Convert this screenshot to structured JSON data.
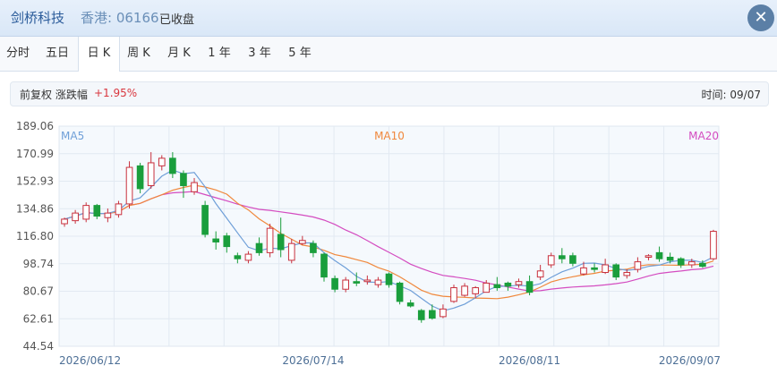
{
  "header": {
    "stock_name": "剑桥科技",
    "market": "香港: 06166",
    "status": "已收盘",
    "close_icon": "close-icon"
  },
  "tabs": [
    {
      "label": "分时"
    },
    {
      "label": "五日"
    },
    {
      "label": "日 K",
      "active": true
    },
    {
      "label": "周 K"
    },
    {
      "label": "月 K"
    },
    {
      "label": "1 年"
    },
    {
      "label": "3 年"
    },
    {
      "label": "5 年"
    }
  ],
  "info": {
    "adjust": "前复权 涨跌幅",
    "change": "+1.95%",
    "time": "时间: 09/07"
  },
  "colors": {
    "up": "#c8303d",
    "down": "#1a9e3c",
    "ma5": "#6f9fd8",
    "ma10": "#f0883c",
    "ma20": "#d44cc0"
  },
  "chart_data": {
    "type": "candlestick",
    "y_ticks": [
      "189.06",
      "170.99",
      "152.93",
      "134.86",
      "116.80",
      "98.74",
      "80.67",
      "62.61",
      "44.54"
    ],
    "ylim": [
      44.54,
      189.06
    ],
    "x_labels": [
      {
        "label": "2026/06/12",
        "index": 5
      },
      {
        "label": "2026/07/14",
        "index": 23
      },
      {
        "label": "2026/08/11",
        "index": 43
      },
      {
        "label": "2026/09/07",
        "index": 60
      }
    ],
    "legend": [
      "MA5",
      "MA10",
      "MA20"
    ],
    "grid": true,
    "candles": [
      [
        125,
        128,
        123,
        129
      ],
      [
        127,
        132,
        125,
        134
      ],
      [
        128,
        137,
        126,
        139
      ],
      [
        137,
        130,
        128,
        138
      ],
      [
        129,
        132,
        126,
        135
      ],
      [
        131,
        138,
        129,
        140
      ],
      [
        138,
        162,
        135,
        166
      ],
      [
        163,
        148,
        145,
        165
      ],
      [
        150,
        165,
        148,
        172
      ],
      [
        163,
        168,
        160,
        170
      ],
      [
        168,
        158,
        155,
        172
      ],
      [
        158,
        150,
        142,
        160
      ],
      [
        146,
        152,
        144,
        155
      ],
      [
        137,
        118,
        116,
        140
      ],
      [
        115,
        113,
        108,
        120
      ],
      [
        117,
        110,
        106,
        119
      ],
      [
        104,
        102,
        99,
        106
      ],
      [
        101,
        105,
        99,
        107
      ],
      [
        112,
        106,
        104,
        116
      ],
      [
        106,
        122,
        103,
        125
      ],
      [
        118,
        108,
        103,
        129
      ],
      [
        101,
        112,
        99,
        115
      ],
      [
        112,
        114,
        111,
        117
      ],
      [
        112,
        106,
        103,
        114
      ],
      [
        105,
        90,
        87,
        106
      ],
      [
        89,
        82,
        80,
        91
      ],
      [
        82,
        88,
        80,
        90
      ],
      [
        87,
        86,
        84,
        93
      ],
      [
        87,
        88,
        85,
        91
      ],
      [
        85,
        88,
        83,
        90
      ],
      [
        92,
        85,
        83,
        93
      ],
      [
        86,
        74,
        72,
        87
      ],
      [
        73,
        71,
        70,
        75
      ],
      [
        68,
        62,
        60,
        69
      ],
      [
        68,
        63,
        62,
        72
      ],
      [
        64,
        69,
        63,
        72
      ],
      [
        74,
        83,
        73,
        85
      ],
      [
        78,
        84,
        77,
        86
      ],
      [
        79,
        83,
        76,
        84
      ],
      [
        80,
        86,
        80,
        88
      ],
      [
        85,
        83,
        81,
        90
      ],
      [
        86,
        84,
        81,
        87
      ],
      [
        85,
        87,
        83,
        89
      ],
      [
        87,
        80,
        78,
        91
      ],
      [
        90,
        94,
        88,
        98
      ],
      [
        98,
        104,
        96,
        106
      ],
      [
        104,
        102,
        99,
        109
      ],
      [
        104,
        99,
        97,
        106
      ],
      [
        92,
        96,
        91,
        100
      ],
      [
        96,
        95,
        93,
        99
      ],
      [
        93,
        98,
        92,
        102
      ],
      [
        98,
        90,
        88,
        99
      ],
      [
        91,
        93,
        89,
        95
      ],
      [
        95,
        100,
        93,
        103
      ],
      [
        103,
        104,
        101,
        105
      ],
      [
        106,
        102,
        100,
        110
      ],
      [
        103,
        101,
        99,
        106
      ],
      [
        102,
        98,
        96,
        103
      ],
      [
        98,
        100,
        96,
        102
      ],
      [
        99,
        97,
        96,
        101
      ],
      [
        102,
        120,
        101,
        121
      ]
    ]
  }
}
